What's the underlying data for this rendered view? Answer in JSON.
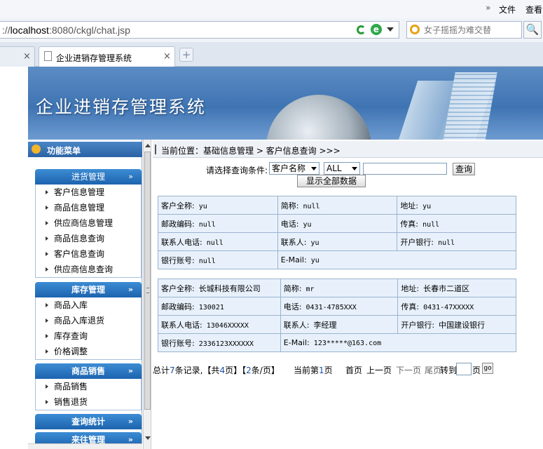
{
  "browser": {
    "menu_chevron": "»",
    "menu_items": [
      "文件",
      "查看"
    ],
    "address_prefix": "://",
    "address_host": "localhost",
    "address_rest": ":8080/ckgl/chat.jsp",
    "search_placeholder": "女子摇摇为难交替",
    "search_icon": "🔍",
    "tab1_close": "×",
    "tab2_title": "企业进销存管理系统",
    "tab2_close": "×",
    "new_tab": "+"
  },
  "banner": {
    "title": "企业进销存管理系统"
  },
  "sidebar": {
    "header": "功能菜单",
    "chevron": "»",
    "groups": [
      {
        "label": "进货管理",
        "items": [
          "客户信息管理",
          "商品信息管理",
          "供应商信息管理",
          "商品信息查询",
          "客户信息查询",
          "供应商信息查询"
        ]
      },
      {
        "label": "库存管理",
        "items": [
          "商品入库",
          "商品入库退货",
          "库存查询",
          "价格调整"
        ]
      },
      {
        "label": "商品销售",
        "items": [
          "商品销售",
          "销售退货"
        ]
      },
      {
        "label": "查询统计",
        "items": []
      },
      {
        "label": "来往管理",
        "items": []
      }
    ]
  },
  "breadcrumb": "当前位置：基础信息管理 > 客户信息查询 >>>",
  "query": {
    "label": "请选择查询条件:",
    "field_select": "客户名称",
    "scope_select": "ALL",
    "input_value": "",
    "search_button": "查询",
    "show_all_button": "显示全部数据"
  },
  "records": [
    {
      "rows": [
        [
          {
            "k": "客户全称:",
            "v": "yu"
          },
          {
            "k": "简称:",
            "v": "null"
          },
          {
            "k": "地址:",
            "v": "yu"
          }
        ],
        [
          {
            "k": "邮政编码:",
            "v": "null"
          },
          {
            "k": "电话:",
            "v": "yu"
          },
          {
            "k": "传真:",
            "v": "null"
          }
        ],
        [
          {
            "k": "联系人电话:",
            "v": "null"
          },
          {
            "k": "联系人:",
            "v": "yu"
          },
          {
            "k": "开户银行:",
            "v": "null"
          }
        ],
        [
          {
            "k": "银行账号:",
            "v": "null"
          },
          {
            "k": "E-Mail:",
            "v": "yu"
          }
        ]
      ]
    },
    {
      "rows": [
        [
          {
            "k": "客户全称:",
            "v": "长城科技有限公司"
          },
          {
            "k": "简称:",
            "v": "mr"
          },
          {
            "k": "地址:",
            "v": "长春市二道区"
          }
        ],
        [
          {
            "k": "邮政编码:",
            "v": "130021"
          },
          {
            "k": "电话:",
            "v": "0431-4785XXX"
          },
          {
            "k": "传真:",
            "v": "0431-47XXXXX"
          }
        ],
        [
          {
            "k": "联系人电话:",
            "v": "13046XXXXX"
          },
          {
            "k": "联系人:",
            "v": "李经理"
          },
          {
            "k": "开户银行:",
            "v": "中国建设银行"
          }
        ],
        [
          {
            "k": "银行账号:",
            "v": "2336123XXXXXX"
          },
          {
            "k": "E-Mail:",
            "v": "123*****@163.com"
          }
        ]
      ]
    }
  ],
  "pager": {
    "summary_a": "总计",
    "total": "7",
    "summary_b": "条记录,【共",
    "pages": "4",
    "summary_c": "页】【",
    "per_page": "2",
    "summary_d": "条/页】",
    "current_a": "当前第",
    "current": "1",
    "current_b": "页",
    "first": "首页",
    "prev": "上一页",
    "next": "下一页",
    "last": "尾页",
    "goto_label": "转到",
    "page_unit": "页",
    "go": "go"
  }
}
